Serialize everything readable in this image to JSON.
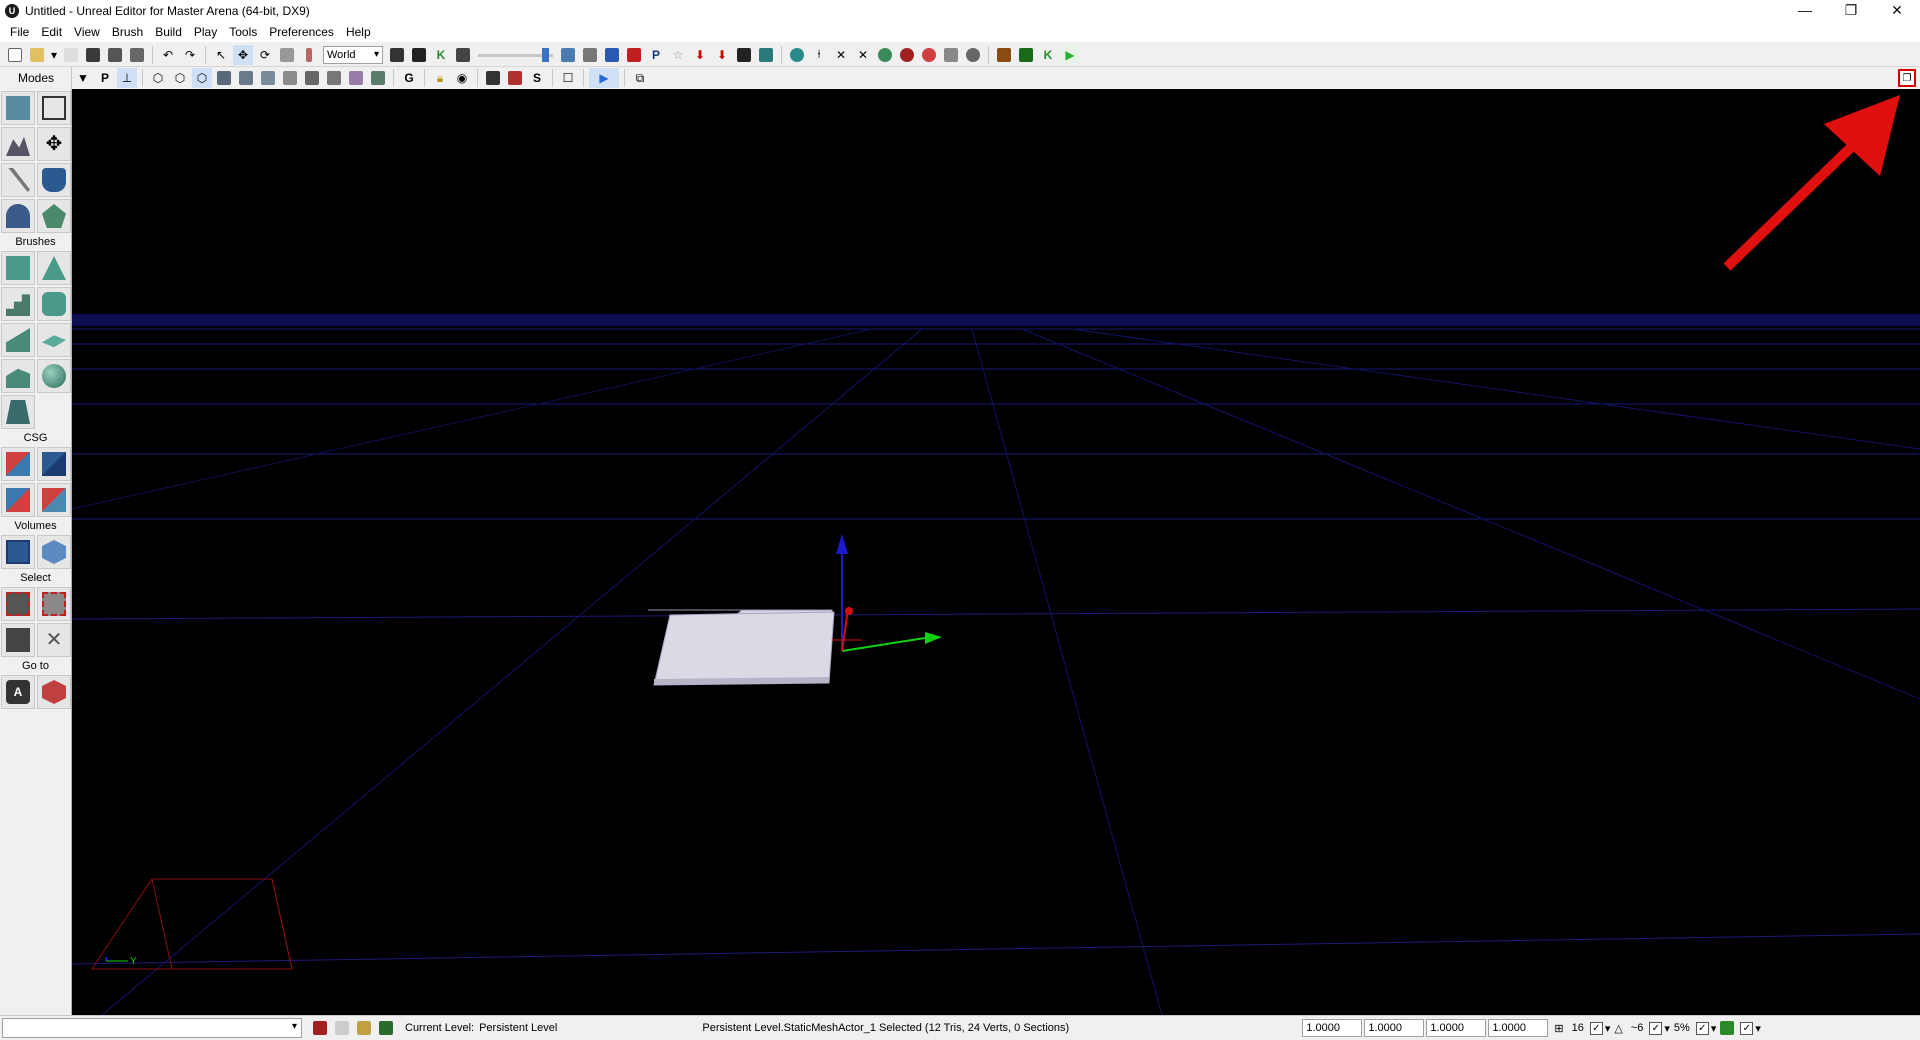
{
  "window": {
    "title": "Untitled - Unreal Editor for Master Arena (64-bit, DX9)",
    "controls": [
      "—",
      "❐",
      "✕"
    ]
  },
  "menu": [
    "File",
    "Edit",
    "View",
    "Brush",
    "Build",
    "Play",
    "Tools",
    "Preferences",
    "Help"
  ],
  "toolbar": {
    "coord_system": "World",
    "accent": "#3a72c8"
  },
  "toolbar2": {
    "modes_label": "Modes",
    "restore_icon": "restore-window-icon",
    "highlight_color": "#d80000"
  },
  "leftpanel": {
    "sections": [
      "Brushes",
      "CSG",
      "Volumes",
      "Select",
      "Go to"
    ]
  },
  "viewport": {
    "background": "#000000",
    "grid_color": "#1a1a7a",
    "mesh_color": "#d8d4e0",
    "axis_y_label": "Y",
    "annotation_arrow_color": "#e01010"
  },
  "status": {
    "current_level_label": "Current Level:",
    "current_level_value": "Persistent Level",
    "selection_info": "Persistent Level.StaticMeshActor_1 Selected (12 Tris, 24 Verts, 0 Sections)",
    "scale_x": "1.0000",
    "scale_y": "1.0000",
    "scale_z": "1.0000",
    "scale_all": "1.0000",
    "grid_size": "16",
    "rotation_snap": "~6",
    "scale_snap": "5%"
  }
}
